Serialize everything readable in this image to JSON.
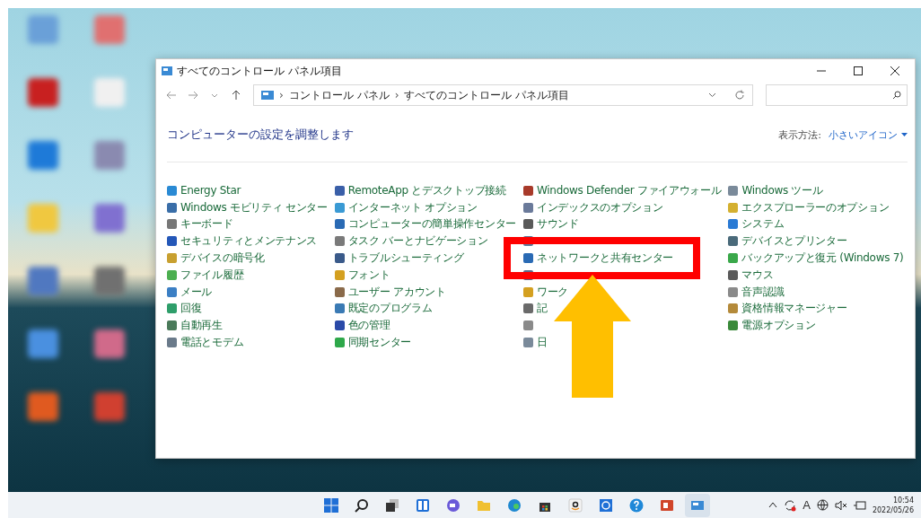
{
  "window": {
    "title": "すべてのコントロール パネル項目",
    "breadcrumb": [
      {
        "separator": "›",
        "label": "コントロール パネル"
      },
      {
        "separator": "›",
        "label": "すべてのコントロール パネル項目"
      }
    ]
  },
  "heading": "コンピューターの設定を調整します",
  "view": {
    "label": "表示方法:",
    "value": "小さいアイコン"
  },
  "columns": [
    {
      "items": [
        {
          "kind": "item",
          "label": "Energy Star",
          "color": "#2a8ad4"
        },
        {
          "kind": "item",
          "label": "Windows モビリティ センター",
          "color": "#3a6ea8"
        },
        {
          "kind": "item",
          "label": "キーボード",
          "color": "#777777"
        },
        {
          "kind": "item",
          "label": "セキュリティとメンテナンス",
          "color": "#2457b8"
        },
        {
          "kind": "item",
          "label": "デバイスの暗号化",
          "color": "#c8a030"
        },
        {
          "kind": "item",
          "label": "ファイル履歴",
          "color": "#4caf50"
        },
        {
          "kind": "item",
          "label": "メール",
          "color": "#3b7fc4"
        },
        {
          "kind": "item",
          "label": "回復",
          "color": "#2e9e6a"
        },
        {
          "kind": "item",
          "label": "自動再生",
          "color": "#4a7a5a"
        },
        {
          "kind": "item",
          "label": "電話とモデム",
          "color": "#6a7a8a"
        }
      ]
    },
    {
      "items": [
        {
          "kind": "item",
          "label": "RemoteApp とデスクトップ接続",
          "color": "#3a5fa8"
        },
        {
          "kind": "item",
          "label": "インターネット オプション",
          "color": "#3a9ad4"
        },
        {
          "kind": "item",
          "label": "コンピューターの簡単操作センター",
          "color": "#2a6ab4"
        },
        {
          "kind": "item",
          "label": "タスク バーとナビゲーション",
          "color": "#7a7a7a"
        },
        {
          "kind": "item",
          "label": "トラブルシューティング",
          "color": "#3a5a8a"
        },
        {
          "kind": "item",
          "label": "フォント",
          "color": "#d4a020"
        },
        {
          "kind": "item",
          "label": "ユーザー アカウント",
          "color": "#8a6a4a"
        },
        {
          "kind": "item",
          "label": "既定のプログラム",
          "color": "#3a7ab4"
        },
        {
          "kind": "item",
          "label": "色の管理",
          "color": "#2a4aa8"
        },
        {
          "kind": "item",
          "label": "同期センター",
          "color": "#2ea84a"
        }
      ]
    },
    {
      "items": [
        {
          "kind": "item",
          "label": "Windows Defender ファイアウォール",
          "color": "#a83a2a"
        },
        {
          "kind": "item",
          "label": "インデックスのオプション",
          "color": "#6a7a9a"
        },
        {
          "kind": "item",
          "label": "サウンド",
          "color": "#5a5a5a"
        },
        {
          "kind": "covered",
          "color": "#5a7a9a"
        },
        {
          "kind": "highlighted",
          "label": "ネットワークと共有センター",
          "color": "#2a6ab4"
        },
        {
          "kind": "covered",
          "color": "#5a6a8a"
        },
        {
          "kind": "item",
          "label": "ワーク",
          "color": "#d4a020"
        },
        {
          "kind": "item",
          "label": "記",
          "color": "#6a6a6a"
        },
        {
          "kind": "covered",
          "color": "#8a8a8a"
        },
        {
          "kind": "item",
          "label": "日",
          "color": "#7a8a9a"
        }
      ]
    },
    {
      "items": [
        {
          "kind": "item",
          "label": "Windows ツール",
          "color": "#7a8a9a"
        },
        {
          "kind": "item",
          "label": "エクスプローラーのオプション",
          "color": "#d4b030"
        },
        {
          "kind": "item",
          "label": "システム",
          "color": "#2a7ad4"
        },
        {
          "kind": "item",
          "label": "デバイスとプリンター",
          "color": "#4a6a7a"
        },
        {
          "kind": "item",
          "label": "バックアップと復元 (Windows 7)",
          "color": "#3aa84a"
        },
        {
          "kind": "item",
          "label": "マウス",
          "color": "#5a5a5a"
        },
        {
          "kind": "item",
          "label": "音声認識",
          "color": "#8a8a8a"
        },
        {
          "kind": "item",
          "label": "資格情報マネージャー",
          "color": "#b48a3a"
        },
        {
          "kind": "item",
          "label": "電源オプション",
          "color": "#3a8a3a"
        }
      ]
    }
  ],
  "desktop_icons": [
    {
      "color": "#6aa0d8"
    },
    {
      "color": "#e07070"
    },
    {
      "color": "#c82020"
    },
    {
      "color": "#f0f0f0"
    },
    {
      "color": "#1e7ad8"
    },
    {
      "color": "#8a8ab0"
    },
    {
      "color": "#f0c840"
    },
    {
      "color": "#8070d0"
    },
    {
      "color": "#5078c0"
    },
    {
      "color": "#707070"
    },
    {
      "color": "#4a90e0"
    },
    {
      "color": "#d06a8a"
    },
    {
      "color": "#e05a20"
    },
    {
      "color": "#d04030"
    }
  ],
  "taskbar": {
    "apps": [
      {
        "kind": "start",
        "selected": false
      },
      {
        "kind": "search",
        "selected": false
      },
      {
        "kind": "taskview",
        "selected": false
      },
      {
        "kind": "widgets",
        "selected": false
      },
      {
        "kind": "chat",
        "selected": false
      },
      {
        "kind": "folder",
        "selected": false
      },
      {
        "kind": "edge",
        "selected": false
      },
      {
        "kind": "store",
        "selected": false
      },
      {
        "kind": "amazon",
        "selected": false
      },
      {
        "kind": "app",
        "selected": false
      },
      {
        "kind": "help",
        "selected": false
      },
      {
        "kind": "powerpoint",
        "selected": false
      },
      {
        "kind": "controlpanel",
        "selected": true
      }
    ],
    "ime": "A",
    "time": "10:54",
    "date": "2022/05/26"
  },
  "annotations": [
    {
      "kind": "arrow"
    }
  ]
}
